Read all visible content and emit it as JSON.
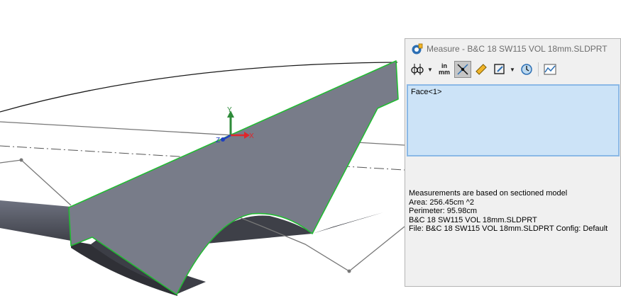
{
  "viewport": {
    "triad": {
      "x_label": "X",
      "y_label": "Y",
      "z_label": "Z"
    },
    "colors": {
      "face": "#787c89",
      "face_shadow": "#4d5058",
      "edge_highlight": "#22bb33",
      "triad_x": "#e0262a",
      "triad_y": "#2e8b3a",
      "triad_z": "#2040c0"
    }
  },
  "measure": {
    "title_icon": "measure-tape-icon",
    "title": "Measure - B&C 18 SW115 VOL 18mm.SLDPRT",
    "toolbar": {
      "icons": [
        "arc-circle-measurements-icon",
        "dropdown-arrow-icon",
        "units-precision-icon",
        "show-xyz-measurements-icon",
        "point-to-point-icon",
        "projected-on-icon",
        "dropdown-arrow-icon",
        "measurement-history-icon",
        "create-sensor-icon"
      ],
      "units_label_top": "in",
      "units_label_bottom": "mm"
    },
    "selection": [
      "Face<1>"
    ],
    "results": {
      "note": "Measurements are based on sectioned model",
      "area": "Area: 256.45cm ^2",
      "perimeter": "Perimeter: 95.98cm",
      "body": "B&C 18 SW115 VOL 18mm.SLDPRT",
      "file": "File: B&C 18 SW115 VOL 18mm.SLDPRT Config: Default"
    }
  }
}
